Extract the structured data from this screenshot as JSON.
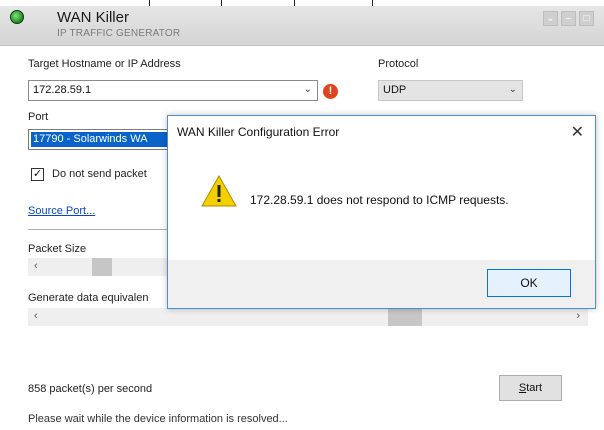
{
  "app": {
    "title": "WAN Killer",
    "subtitle": "IP TRAFFIC GENERATOR",
    "window_controls": [
      "chevron-down-icon",
      "minimize-icon",
      "close-icon"
    ]
  },
  "form": {
    "target_label": "Target Hostname or IP Address",
    "target_value": "172.28.59.1",
    "protocol_label": "Protocol",
    "protocol_value": "UDP",
    "port_label": "Port",
    "port_value": "17790 - Solarwinds WA",
    "checkbox_label": "Do not send packet",
    "checkbox_checked": true,
    "source_port_link": "Source Port...",
    "packet_size_label": "Packet Size",
    "generate_label": "Generate data equivalen",
    "packets_per_second": "858 packet(s) per second",
    "start_button": "Start",
    "start_button_mnemonic": "S",
    "start_button_rest": "tart",
    "status_text": "Please wait while the device information is resolved..."
  },
  "dialog": {
    "title": "WAN Killer Configuration Error",
    "message": "172.28.59.1 does not respond to ICMP requests.",
    "ok_button": "OK"
  },
  "colors": {
    "accent": "#0078d7",
    "selection": "#0a63c9",
    "link": "#0a46c4",
    "error_icon": "#e2431d",
    "warning": "#f5d000"
  }
}
